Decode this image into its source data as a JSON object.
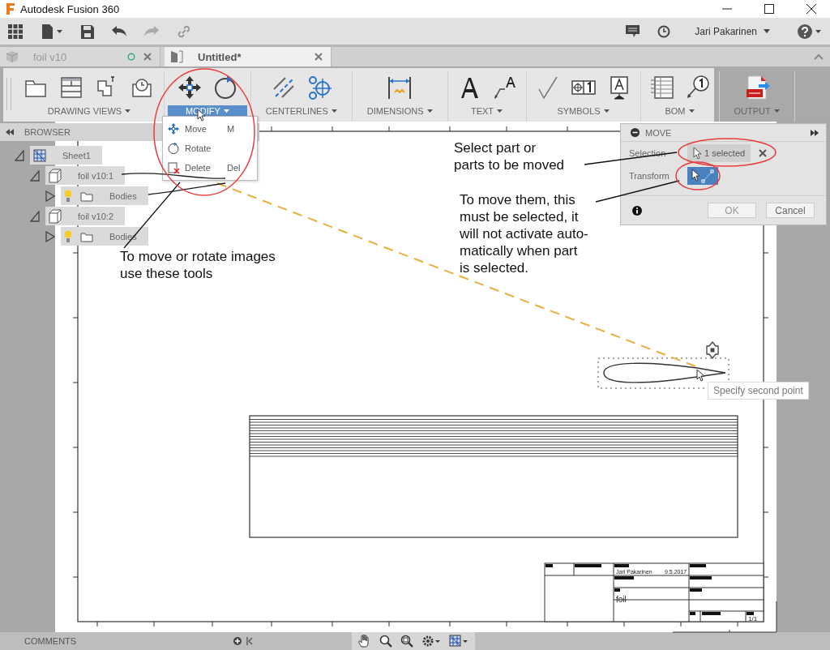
{
  "window": {
    "title": "Autodesk Fusion 360"
  },
  "app_bar": {
    "user": "Jari Pakarinen"
  },
  "tabs": [
    {
      "label": "foil v10",
      "selected": false
    },
    {
      "label": "Untitled*",
      "selected": true
    }
  ],
  "ribbon": [
    {
      "label": "DRAWING VIEWS",
      "selected": false
    },
    {
      "label": "MODIFY",
      "selected": true
    },
    {
      "label": "CENTERLINES",
      "selected": false
    },
    {
      "label": "DIMENSIONS",
      "selected": false
    },
    {
      "label": "TEXT",
      "selected": false
    },
    {
      "label": "SYMBOLS",
      "selected": false
    },
    {
      "label": "BOM",
      "selected": false
    },
    {
      "label": "OUTPUT",
      "selected": false
    }
  ],
  "modify_menu": [
    {
      "label": "Move",
      "shortcut": "M"
    },
    {
      "label": "Rotate"
    },
    {
      "label": "Delete",
      "shortcut": "Del"
    }
  ],
  "browser": {
    "title": "BROWSER",
    "tree": [
      {
        "label": "Sheet1",
        "kind": "sheet",
        "expanded": true,
        "children": [
          {
            "label": "foil v10:1",
            "kind": "component",
            "expanded": true,
            "children": [
              {
                "label": "Bodies",
                "kind": "bodies",
                "expanded": false
              }
            ]
          },
          {
            "label": "foil v10:2",
            "kind": "component",
            "expanded": true,
            "children": [
              {
                "label": "Bodies",
                "kind": "bodies",
                "expanded": false
              }
            ]
          }
        ]
      }
    ]
  },
  "move_dialog": {
    "title": "MOVE",
    "selection_label": "Selection",
    "selection_value": "1 selected",
    "transform_label": "Transform",
    "transform_selected": true,
    "buttons": [
      "OK",
      "Cancel"
    ]
  },
  "annotations": [
    "To move or rotate images\nuse these tools",
    "Select part or\nparts to be moved",
    "To move them, this\nmust be selected, it\nwill not activate auto-\nmatically when part\nis selected."
  ],
  "tooltip": "Specify second point",
  "title_block": {
    "author": "Jari Pakarinen",
    "date": "9.5.2017",
    "title": "foil",
    "sheet": "1/1"
  },
  "status_bar": {
    "label": "COMMENTS"
  }
}
